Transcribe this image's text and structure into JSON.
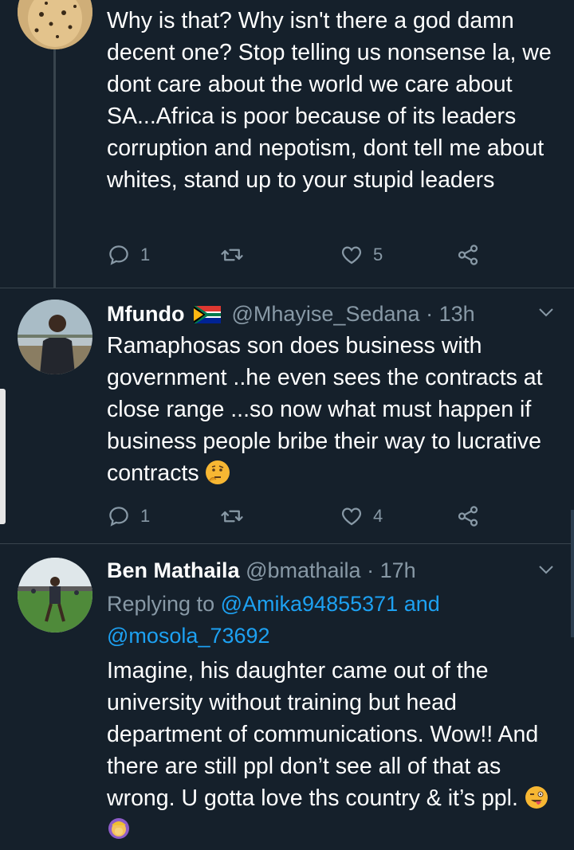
{
  "colors": {
    "background": "#15202b",
    "divider": "#38444d",
    "secondary_text": "#8899a6",
    "link": "#1da1f2"
  },
  "tweets": [
    {
      "avatar_icon": "cheetah-avatar",
      "text": "Why is that? Why isn't there a god damn decent one? Stop telling us nonsense la, we dont care about the world we care about SA...Africa is poor because of its leaders corruption and nepotism, dont tell me about whites, stand up to your stupid leaders",
      "replies": "1",
      "retweets": "",
      "likes": "5"
    },
    {
      "name": "Mfundo",
      "flag_icon": "south-africa-flag-icon",
      "handle": "@Mhayise_Sedana",
      "separator": "·",
      "time": "13h",
      "text": "Ramaphosas son does business with government ..he even sees the contracts at close range ...so now what must happen if business people bribe their way to lucrative contracts",
      "trailing_emoji": "thinking-face-emoji",
      "replies": "1",
      "retweets": "",
      "likes": "4"
    },
    {
      "name": "Ben Mathaila",
      "handle": "@bmathaila",
      "separator": "·",
      "time": "17h",
      "replying_prefix": "Replying to",
      "mention_1": "@Amika94855371",
      "mention_joiner": "and",
      "mention_2": "@mosola_73692",
      "text": "Imagine, his daughter came out of the university without training but head department of communications. Wow!! And there are still ppl don’t see all of that as wrong. U gotta love ths country & it’s ppl.",
      "trailing_emojis": [
        "winking-tongue-face-emoji",
        "woman-facepalming-emoji"
      ]
    }
  ]
}
